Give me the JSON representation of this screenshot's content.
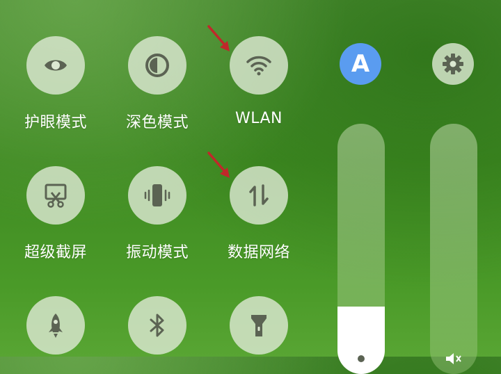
{
  "tiles": [
    {
      "label": "护眼模式",
      "icon": "eye-icon"
    },
    {
      "label": "深色模式",
      "icon": "dark-mode-icon"
    },
    {
      "label": "WLAN",
      "icon": "wifi-icon"
    },
    {
      "label": "超级截屏",
      "icon": "screenshot-icon"
    },
    {
      "label": "振动模式",
      "icon": "vibrate-icon"
    },
    {
      "label": "数据网络",
      "icon": "mobile-data-icon"
    },
    {
      "label": "",
      "icon": "rocket-icon"
    },
    {
      "label": "",
      "icon": "bluetooth-icon"
    },
    {
      "label": "",
      "icon": "flashlight-icon"
    }
  ],
  "auto_brightness": {
    "letter": "A",
    "icon": "auto-brightness-icon",
    "color": "#5a9cf0"
  },
  "settings": {
    "icon": "gear-icon"
  },
  "brightness_slider": {
    "level": 0.2
  },
  "volume_slider": {
    "level": 0.0
  },
  "colors": {
    "icon_gray": "#5b6353",
    "arrow_red": "#c0282a",
    "tile_bg": "#dce8d2"
  }
}
